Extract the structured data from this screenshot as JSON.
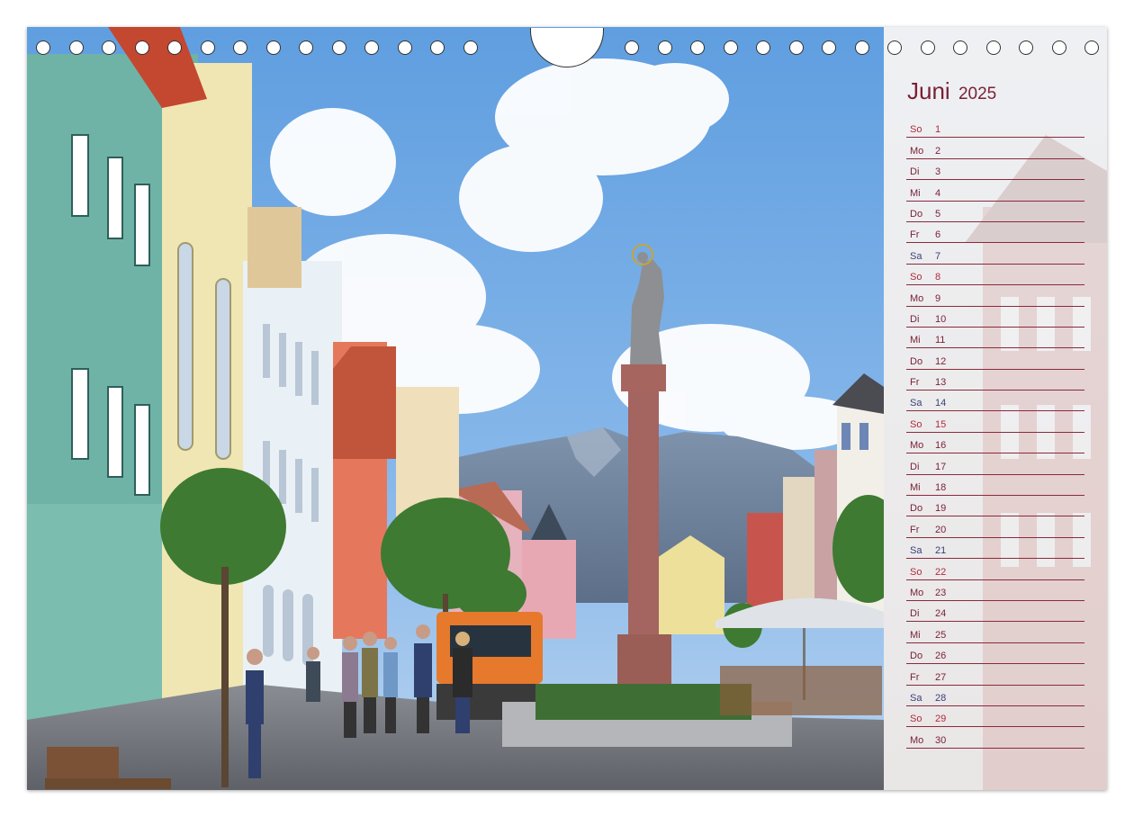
{
  "calendar": {
    "month": "Juni",
    "year": "2025",
    "days": [
      {
        "wd": "So",
        "n": "1",
        "kind": "sun"
      },
      {
        "wd": "Mo",
        "n": "2",
        "kind": "wk"
      },
      {
        "wd": "Di",
        "n": "3",
        "kind": "wk"
      },
      {
        "wd": "Mi",
        "n": "4",
        "kind": "wk"
      },
      {
        "wd": "Do",
        "n": "5",
        "kind": "wk"
      },
      {
        "wd": "Fr",
        "n": "6",
        "kind": "wk"
      },
      {
        "wd": "Sa",
        "n": "7",
        "kind": "sat"
      },
      {
        "wd": "So",
        "n": "8",
        "kind": "sun"
      },
      {
        "wd": "Mo",
        "n": "9",
        "kind": "wk"
      },
      {
        "wd": "Di",
        "n": "10",
        "kind": "wk"
      },
      {
        "wd": "Mi",
        "n": "11",
        "kind": "wk"
      },
      {
        "wd": "Do",
        "n": "12",
        "kind": "wk"
      },
      {
        "wd": "Fr",
        "n": "13",
        "kind": "wk"
      },
      {
        "wd": "Sa",
        "n": "14",
        "kind": "sat"
      },
      {
        "wd": "So",
        "n": "15",
        "kind": "sun"
      },
      {
        "wd": "Mo",
        "n": "16",
        "kind": "wk"
      },
      {
        "wd": "Di",
        "n": "17",
        "kind": "wk"
      },
      {
        "wd": "Mi",
        "n": "18",
        "kind": "wk"
      },
      {
        "wd": "Do",
        "n": "19",
        "kind": "wk"
      },
      {
        "wd": "Fr",
        "n": "20",
        "kind": "wk"
      },
      {
        "wd": "Sa",
        "n": "21",
        "kind": "sat"
      },
      {
        "wd": "So",
        "n": "22",
        "kind": "sun"
      },
      {
        "wd": "Mo",
        "n": "23",
        "kind": "wk"
      },
      {
        "wd": "Di",
        "n": "24",
        "kind": "wk"
      },
      {
        "wd": "Mi",
        "n": "25",
        "kind": "wk"
      },
      {
        "wd": "Do",
        "n": "26",
        "kind": "wk"
      },
      {
        "wd": "Fr",
        "n": "27",
        "kind": "wk"
      },
      {
        "wd": "Sa",
        "n": "28",
        "kind": "sat"
      },
      {
        "wd": "So",
        "n": "29",
        "kind": "sun"
      },
      {
        "wd": "Mo",
        "n": "30",
        "kind": "wk"
      }
    ]
  },
  "colors": {
    "accent": "#7a1f33",
    "rule": "#8a2a3c",
    "saturday": "#3a3f7a",
    "sunday": "#b02b3c"
  },
  "icons": {
    "binding": "spiral-binding-holes",
    "hanger": "hanger-cutout"
  }
}
